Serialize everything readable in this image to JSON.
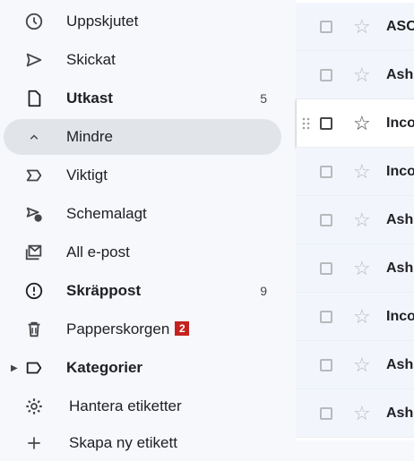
{
  "sidebar": {
    "items": [
      {
        "label": "Uppskjutet",
        "icon": "clock-icon"
      },
      {
        "label": "Skickat",
        "icon": "send-icon"
      },
      {
        "label": "Utkast",
        "icon": "draft-icon",
        "count": "5"
      },
      {
        "label": "Mindre",
        "icon": "chevron-up-icon"
      },
      {
        "label": "Viktigt",
        "icon": "important-icon"
      },
      {
        "label": "Schemalagt",
        "icon": "scheduled-send-icon"
      },
      {
        "label": "All e-post",
        "icon": "all-mail-icon"
      },
      {
        "label": "Skräppost",
        "icon": "spam-icon",
        "count": "9"
      },
      {
        "label": "Papperskorgen",
        "icon": "trash-icon",
        "badge": "2"
      },
      {
        "label": "Kategorier",
        "icon": "label-icon"
      },
      {
        "label": "Hantera etiketter",
        "icon": "gear-icon"
      },
      {
        "label": "Skapa ny etikett",
        "icon": "plus-icon"
      }
    ]
  },
  "messages": [
    {
      "sender": "ASC"
    },
    {
      "sender": "Ash"
    },
    {
      "sender": "Inco"
    },
    {
      "sender": "Inco"
    },
    {
      "sender": "Ash"
    },
    {
      "sender": "Ash"
    },
    {
      "sender": "Inco"
    },
    {
      "sender": "Ash"
    },
    {
      "sender": "Ash"
    }
  ],
  "colors": {
    "badge": "#c5221f",
    "active_bg": "#e1e5ea",
    "sidebar_bg": "#f6f8fc"
  }
}
